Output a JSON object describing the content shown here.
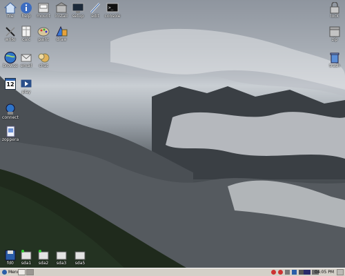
{
  "desktop": {
    "left_icons": [
      {
        "name": "file-icon",
        "label": "file"
      },
      {
        "name": "help-icon",
        "label": "help"
      },
      {
        "name": "mount-icon",
        "label": "mount"
      },
      {
        "name": "install-icon",
        "label": "install"
      },
      {
        "name": "setup-icon",
        "label": "setup"
      },
      {
        "name": "edit-icon",
        "label": "edit"
      },
      {
        "name": "console-icon",
        "label": "console"
      },
      {
        "name": "write-icon",
        "label": "write"
      },
      {
        "name": "calc-icon",
        "label": "calc"
      },
      {
        "name": "paint-icon",
        "label": "paint"
      },
      {
        "name": "draw-icon",
        "label": "draw"
      },
      {
        "name": "browse-icon",
        "label": "browse"
      },
      {
        "name": "email-icon",
        "label": "email"
      },
      {
        "name": "chat-icon",
        "label": "chat"
      },
      {
        "name": "calendar-icon",
        "label": "12"
      },
      {
        "name": "play-icon",
        "label": "play"
      },
      {
        "name": "connect-icon",
        "label": "connect"
      },
      {
        "name": "zoppera-icon",
        "label": "zoppera"
      }
    ],
    "right_icons": [
      {
        "name": "lock-icon",
        "label": "lock"
      },
      {
        "name": "zip-icon",
        "label": "zip"
      },
      {
        "name": "trash-icon",
        "label": "trash"
      }
    ],
    "drives": [
      {
        "name": "fd0-drive",
        "label": "fd0"
      },
      {
        "name": "sda1-drive",
        "label": "sda1"
      },
      {
        "name": "sda2-drive",
        "label": "sda2"
      },
      {
        "name": "sda3-drive",
        "label": "sda3"
      },
      {
        "name": "sda5-drive",
        "label": "sda5"
      }
    ]
  },
  "taskbar": {
    "menu_label": "Menu",
    "clock": "04:05 PM"
  },
  "colors": {
    "taskbar_bg": "#d4d0c8",
    "accent_blue": "#2b5ea8"
  }
}
